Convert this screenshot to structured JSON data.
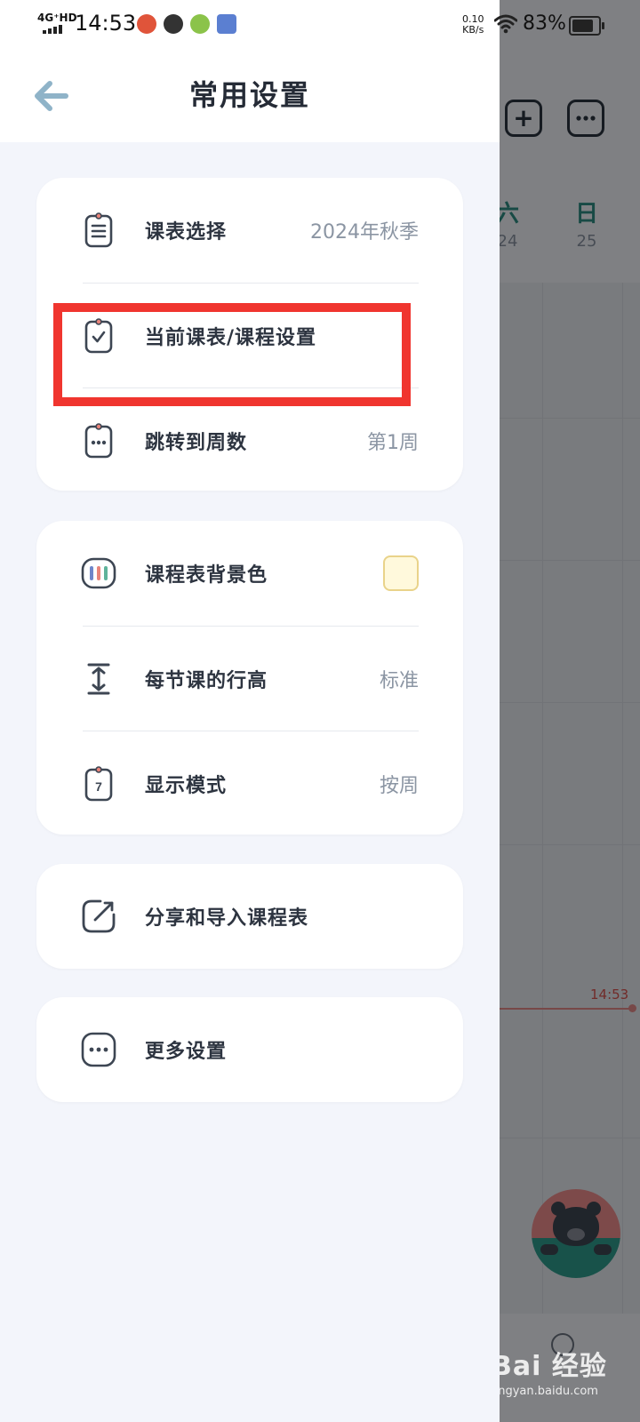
{
  "status_bar": {
    "network": "4G⁺HD",
    "time": "14:53",
    "speed_value": "0.10",
    "speed_unit": "KB/s",
    "battery": "83%"
  },
  "header": {
    "title": "常用设置"
  },
  "card1": {
    "timetable_select": {
      "label": "课表选择",
      "value": "2024年秋季",
      "icon": "clipboard-list-icon"
    },
    "current_settings": {
      "label": "当前课表/课程设置",
      "icon": "clipboard-check-icon"
    },
    "jump_week": {
      "label": "跳转到周数",
      "value": "第1周",
      "icon": "clipboard-dots-icon"
    }
  },
  "card2": {
    "bg_color": {
      "label": "课程表背景色",
      "swatch_color": "#fff9dc",
      "icon": "palette-icon"
    },
    "row_height": {
      "label": "每节课的行高",
      "value": "标准",
      "icon": "row-height-icon"
    },
    "display_mode": {
      "label": "显示模式",
      "value": "按周",
      "icon": "calendar-7-icon",
      "icon_text": "7"
    }
  },
  "card3": {
    "share_import": {
      "label": "分享和导入课程表",
      "icon": "share-icon"
    }
  },
  "card4": {
    "more_settings": {
      "label": "更多设置",
      "icon": "more-icon"
    }
  },
  "background": {
    "days": [
      {
        "name": "六",
        "date": "24"
      },
      {
        "name": "日",
        "date": "25"
      }
    ],
    "current_time": "14:53",
    "watermark_main": "Bai 经验",
    "watermark_sub": "jingyan.baidu.com"
  },
  "colors": {
    "accent_teal": "#2e8f84",
    "highlight_red": "#f0352f",
    "back_arrow": "#8fb3c8"
  }
}
